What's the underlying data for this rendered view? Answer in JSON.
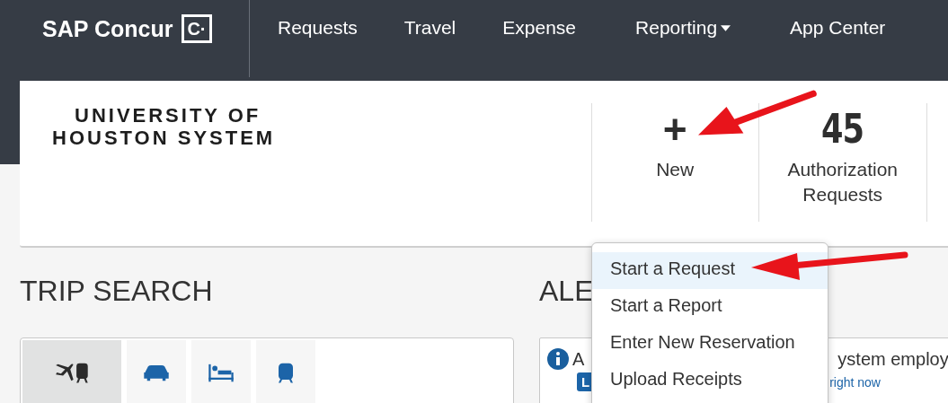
{
  "header": {
    "logo": "SAP Concur",
    "logo_mark": "C·",
    "nav": [
      {
        "label": "Requests",
        "dropdown": false
      },
      {
        "label": "Travel",
        "dropdown": false
      },
      {
        "label": "Expense",
        "dropdown": false
      },
      {
        "label": "Reporting",
        "dropdown": true
      },
      {
        "label": "App Center",
        "dropdown": false
      }
    ]
  },
  "banner": {
    "org_lines": [
      "UNIVERSITY OF",
      "HOUSTON SYSTEM"
    ],
    "tiles": [
      {
        "kind": "new",
        "value": "+",
        "label": "New"
      },
      {
        "kind": "count",
        "value": "45",
        "label": "Authorization Requests"
      }
    ]
  },
  "trip_search": {
    "title": "TRIP SEARCH",
    "modes": [
      {
        "kind": "flight-train",
        "selected": true
      },
      {
        "kind": "car",
        "selected": false
      },
      {
        "kind": "hotel",
        "selected": false
      },
      {
        "kind": "train",
        "selected": false
      }
    ]
  },
  "alerts": {
    "title": "ALE",
    "message_start": "A",
    "message_end": "ystem employ",
    "badge": "L",
    "link": "right now"
  },
  "new_menu": {
    "items": [
      {
        "label": "Start a Request",
        "selected": true
      },
      {
        "label": "Start a Report",
        "selected": false
      },
      {
        "label": "Enter New Reservation",
        "selected": false
      },
      {
        "label": "Upload Receipts",
        "selected": false
      }
    ]
  }
}
